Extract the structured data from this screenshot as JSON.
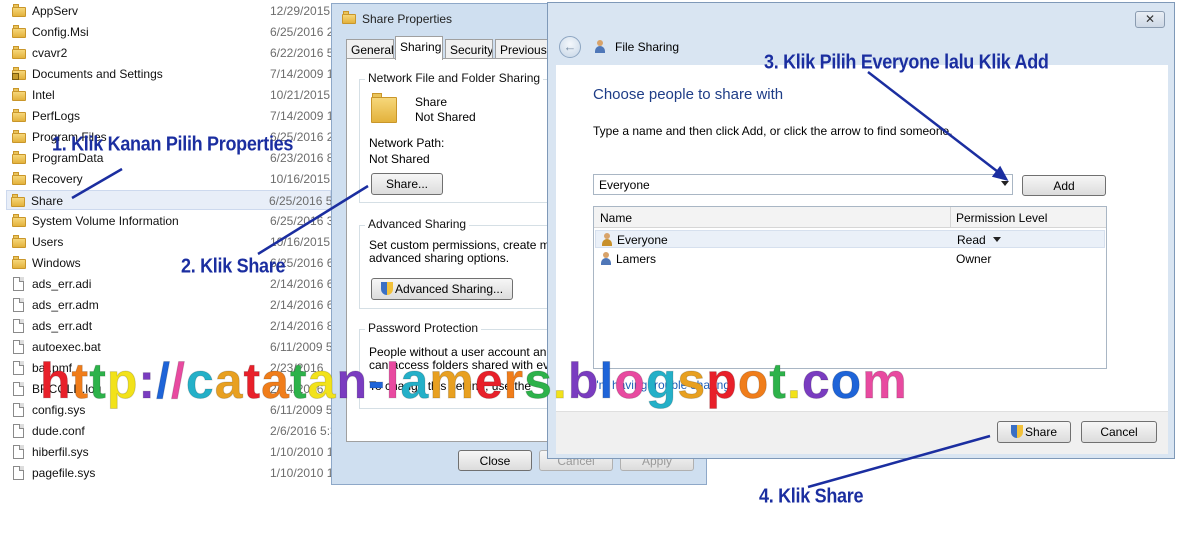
{
  "explorer": {
    "files": [
      {
        "name": "AppServ",
        "date": "12/29/2015",
        "type": "folder"
      },
      {
        "name": "Config.Msi",
        "date": "6/25/2016 2",
        "type": "folder"
      },
      {
        "name": "cvavr2",
        "date": "6/22/2016 5",
        "type": "folder"
      },
      {
        "name": "Documents and Settings",
        "date": "7/14/2009 1",
        "type": "locked-folder"
      },
      {
        "name": "Intel",
        "date": "10/21/2015",
        "type": "folder"
      },
      {
        "name": "PerfLogs",
        "date": "7/14/2009 1",
        "type": "folder"
      },
      {
        "name": "Program Files",
        "date": "6/25/2016 2",
        "type": "folder"
      },
      {
        "name": "ProgramData",
        "date": "6/23/2016 8",
        "type": "folder"
      },
      {
        "name": "Recovery",
        "date": "10/16/2015",
        "type": "folder"
      },
      {
        "name": "Share",
        "date": "6/25/2016 5",
        "type": "folder",
        "selected": true
      },
      {
        "name": "System Volume Information",
        "date": "6/25/2016 3",
        "type": "folder"
      },
      {
        "name": "Users",
        "date": "10/16/2015",
        "type": "folder"
      },
      {
        "name": "Windows",
        "date": "6/25/2016 6",
        "type": "folder"
      },
      {
        "name": "ads_err.adi",
        "date": "2/14/2016 6",
        "type": "file"
      },
      {
        "name": "ads_err.adm",
        "date": "2/14/2016 6",
        "type": "file"
      },
      {
        "name": "ads_err.adt",
        "date": "2/14/2016 8",
        "type": "file"
      },
      {
        "name": "autoexec.bat",
        "date": "6/11/2009 5",
        "type": "file"
      },
      {
        "name": "bar.pmf",
        "date": "2/23/2016",
        "type": "file"
      },
      {
        "name": "BRCOLD.log",
        "date": "2/14/2016",
        "type": "file"
      },
      {
        "name": "config.sys",
        "date": "6/11/2009 5",
        "type": "file"
      },
      {
        "name": "dude.conf",
        "date": "2/6/2016 5:3",
        "type": "file"
      },
      {
        "name": "hiberfil.sys",
        "date": "1/10/2010 1",
        "type": "file"
      },
      {
        "name": "pagefile.sys",
        "date": "1/10/2010 1",
        "type": "file"
      }
    ]
  },
  "properties": {
    "title": "Share Properties",
    "tabs": [
      "General",
      "Sharing",
      "Security",
      "Previous V"
    ],
    "network_group": "Network File and Folder Sharing",
    "folder_name": "Share",
    "folder_status": "Not Shared",
    "network_path_label": "Network Path:",
    "network_path_value": "Not Shared",
    "share_button": "Share...",
    "advanced_group": "Advanced Sharing",
    "advanced_desc_1": "Set custom permissions, create multipl",
    "advanced_desc_2": "advanced sharing options.",
    "advanced_button": "Advanced Sharing...",
    "password_group": "Password Protection",
    "password_desc_1": "People without a user account and pa",
    "password_desc_2": "can access folders shared with everyo",
    "password_desc_3": "To change this setting, use the",
    "close_button": "Close",
    "cancel_button": "Cancel",
    "apply_button": "Apply"
  },
  "file_sharing": {
    "title": "File Sharing",
    "close_glyph": "✕",
    "back_glyph": "←",
    "heading": "Choose people to share with",
    "instruction": "Type a name and then click Add, or click the arrow to find someone.",
    "combo_value": "Everyone",
    "add_button": "Add",
    "col_name": "Name",
    "col_permission": "Permission Level",
    "rows": [
      {
        "name": "Everyone",
        "permission": "Read"
      },
      {
        "name": "Lamers",
        "permission": "Owner"
      }
    ],
    "trouble_link": "I'm having trouble sharing",
    "share_button": "Share",
    "cancel_button": "Cancel"
  },
  "annotations": {
    "step1": "1. Klik Kanan Pilih Properties",
    "step2": "2. Klik Share",
    "step3": "3. Klik Pilih Everyone lalu Klik Add",
    "step4": "4. Klik Share"
  },
  "watermark": {
    "text": "http://catatan-lamers.blogspot.com"
  },
  "colors": {
    "annotation": "#1b2ea0",
    "heading_blue": "#1e3d87",
    "watermark_palette": [
      "#e8202a",
      "#f07d1a",
      "#2db24a",
      "#f2e21a",
      "#7a3cc0",
      "#1e64d8",
      "#e84aa0",
      "#24b0c8",
      "#e8a020"
    ]
  }
}
